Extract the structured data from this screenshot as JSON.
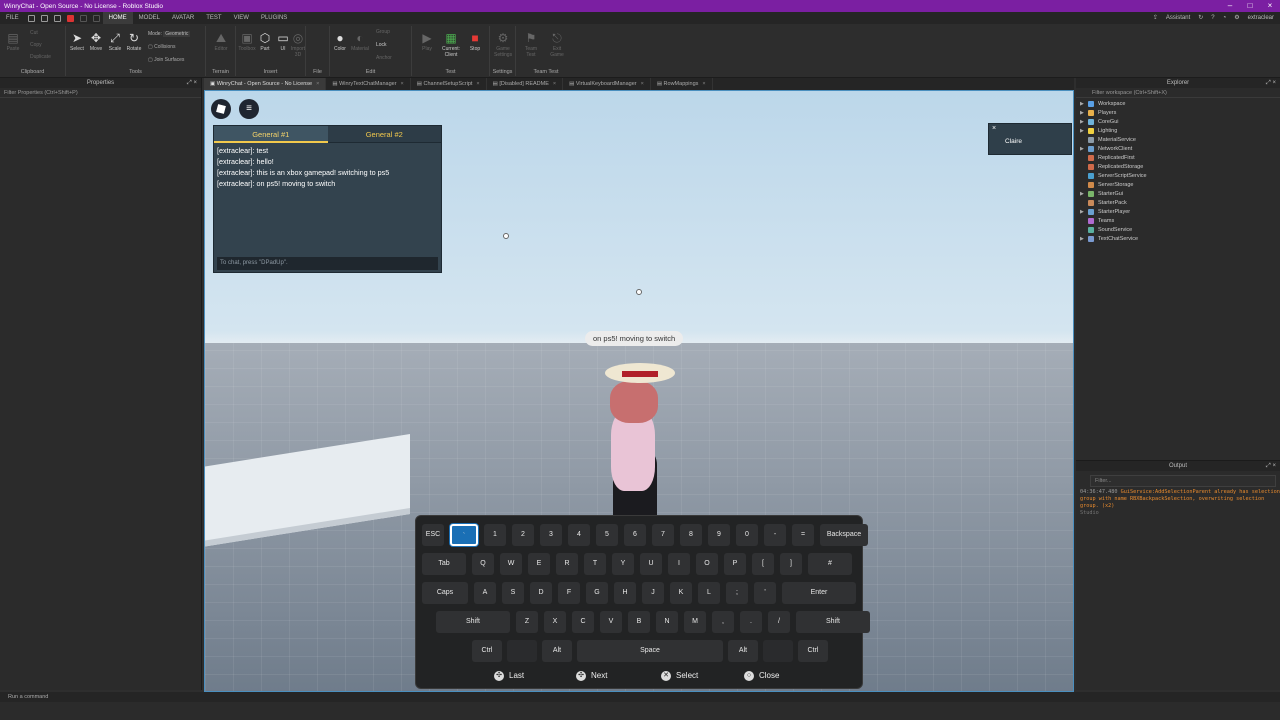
{
  "window": {
    "title": "WinryChat - Open Source - No License - Roblox Studio"
  },
  "menubar": {
    "items": [
      "FILE",
      "HOME",
      "MODEL",
      "AVATAR",
      "TEST",
      "VIEW",
      "PLUGINS"
    ],
    "assistant": "Assistant",
    "user": "extraclear"
  },
  "ribbon": {
    "clipboard": {
      "label": "Clipboard",
      "tools": [
        "Paste",
        "Cut",
        "Copy",
        "Duplicate"
      ]
    },
    "tools": {
      "label": "Tools",
      "items": [
        "Select",
        "Move",
        "Scale",
        "Rotate"
      ],
      "mode_label": "Mode:",
      "mode_value": "Geometric",
      "collisions": "Collisions",
      "join": "Join Surfaces"
    },
    "terrain": {
      "label": "Terrain",
      "items": [
        "Editor"
      ]
    },
    "insert": {
      "label": "Insert",
      "items": [
        "Toolbox",
        "Part",
        "UI",
        "Import 3D"
      ]
    },
    "file": {
      "label": "File"
    },
    "edit": {
      "label": "Edit",
      "items": [
        "Color",
        "Material",
        "Group",
        "Lock",
        "Anchor"
      ]
    },
    "test": {
      "label": "Test",
      "items": [
        "Play",
        "Current: Client",
        "Stop"
      ]
    },
    "settings": {
      "label": "Settings",
      "items": [
        "Game Settings"
      ]
    },
    "teamtest": {
      "label": "Team Test",
      "items": [
        "Team Test",
        "Exit Game"
      ]
    }
  },
  "properties": {
    "title": "Properties",
    "filter": "Filter Properties (Ctrl+Shift+P)"
  },
  "tabs": [
    {
      "label": "WinryChat - Open Source - No License",
      "active": true
    },
    {
      "label": "WinryTextChatManager",
      "active": false
    },
    {
      "label": "ChannelSetupScript",
      "active": false
    },
    {
      "label": "[Disabled] README",
      "active": false
    },
    {
      "label": "VirtualKeyboardManager",
      "active": false
    },
    {
      "label": "RowMappings",
      "active": false
    }
  ],
  "chat": {
    "tabs": [
      "General #1",
      "General #2"
    ],
    "messages": [
      "[extraclear]: test",
      "[extraclear]: hello!",
      "[extraclear]: this is an xbox gamepad! switching to ps5",
      "[extraclear]: on ps5! moving to switch"
    ],
    "input_placeholder": "To chat, press \"DPadUp\"."
  },
  "player_card": {
    "name": "Claire",
    "close": "×"
  },
  "bubble": "on ps5! moving to switch",
  "keyboard": {
    "rows": [
      [
        "ESC",
        "`",
        "1",
        "2",
        "3",
        "4",
        "5",
        "6",
        "7",
        "8",
        "9",
        "0",
        "-",
        "=",
        "Backspace"
      ],
      [
        "Tab",
        "Q",
        "W",
        "E",
        "R",
        "T",
        "Y",
        "U",
        "I",
        "O",
        "P",
        "[",
        "]",
        "#"
      ],
      [
        "Caps",
        "A",
        "S",
        "D",
        "F",
        "G",
        "H",
        "J",
        "K",
        "L",
        ";",
        "'",
        "Enter"
      ],
      [
        "Shift",
        "Z",
        "X",
        "C",
        "V",
        "B",
        "N",
        "M",
        ",",
        ".",
        "/",
        "Shift"
      ],
      [
        "Ctrl",
        "",
        "Alt",
        "Space",
        "Alt",
        "",
        "Ctrl"
      ]
    ],
    "selected": "`",
    "hints": [
      {
        "label": "Last",
        "icon": "dpad-icon"
      },
      {
        "label": "Next",
        "icon": "dpad-icon"
      },
      {
        "label": "Select",
        "icon": "cross-button-icon"
      },
      {
        "label": "Close",
        "icon": "circle-button-icon"
      }
    ]
  },
  "explorer": {
    "title": "Explorer",
    "filter": "Filter workspace (Ctrl+Shift+X)",
    "nodes": [
      {
        "label": "Workspace",
        "expandable": true,
        "color": "#5aa0e6"
      },
      {
        "label": "Players",
        "expandable": true,
        "color": "#e8b04b"
      },
      {
        "label": "CoreGui",
        "expandable": true,
        "color": "#6fb3d9"
      },
      {
        "label": "Lighting",
        "expandable": true,
        "color": "#f0d040"
      },
      {
        "label": "MaterialService",
        "expandable": false,
        "color": "#8c9ba8"
      },
      {
        "label": "NetworkClient",
        "expandable": true,
        "color": "#6c9fcf"
      },
      {
        "label": "ReplicatedFirst",
        "expandable": false,
        "color": "#d06a4a"
      },
      {
        "label": "ReplicatedStorage",
        "expandable": false,
        "color": "#d06a4a"
      },
      {
        "label": "ServerScriptService",
        "expandable": false,
        "color": "#4aa0d0"
      },
      {
        "label": "ServerStorage",
        "expandable": false,
        "color": "#d08a4a"
      },
      {
        "label": "StarterGui",
        "expandable": true,
        "color": "#7ab56a"
      },
      {
        "label": "StarterPack",
        "expandable": false,
        "color": "#c98a5a"
      },
      {
        "label": "StarterPlayer",
        "expandable": true,
        "color": "#6aa0d0"
      },
      {
        "label": "Teams",
        "expandable": false,
        "color": "#b06ad0"
      },
      {
        "label": "SoundService",
        "expandable": false,
        "color": "#5ab0a0"
      },
      {
        "label": "TextChatService",
        "expandable": true,
        "color": "#7a9ad0"
      }
    ]
  },
  "output": {
    "title": "Output",
    "filter": "Filter...",
    "logs": [
      {
        "time": "04:36:47.480",
        "text": "GuiService:AddSelectionParent already has selection group with name RBXBackpackSelection, overwriting selection group. (x2)",
        "source": "Studio"
      }
    ]
  },
  "command_bar": {
    "placeholder": "Run a command"
  }
}
